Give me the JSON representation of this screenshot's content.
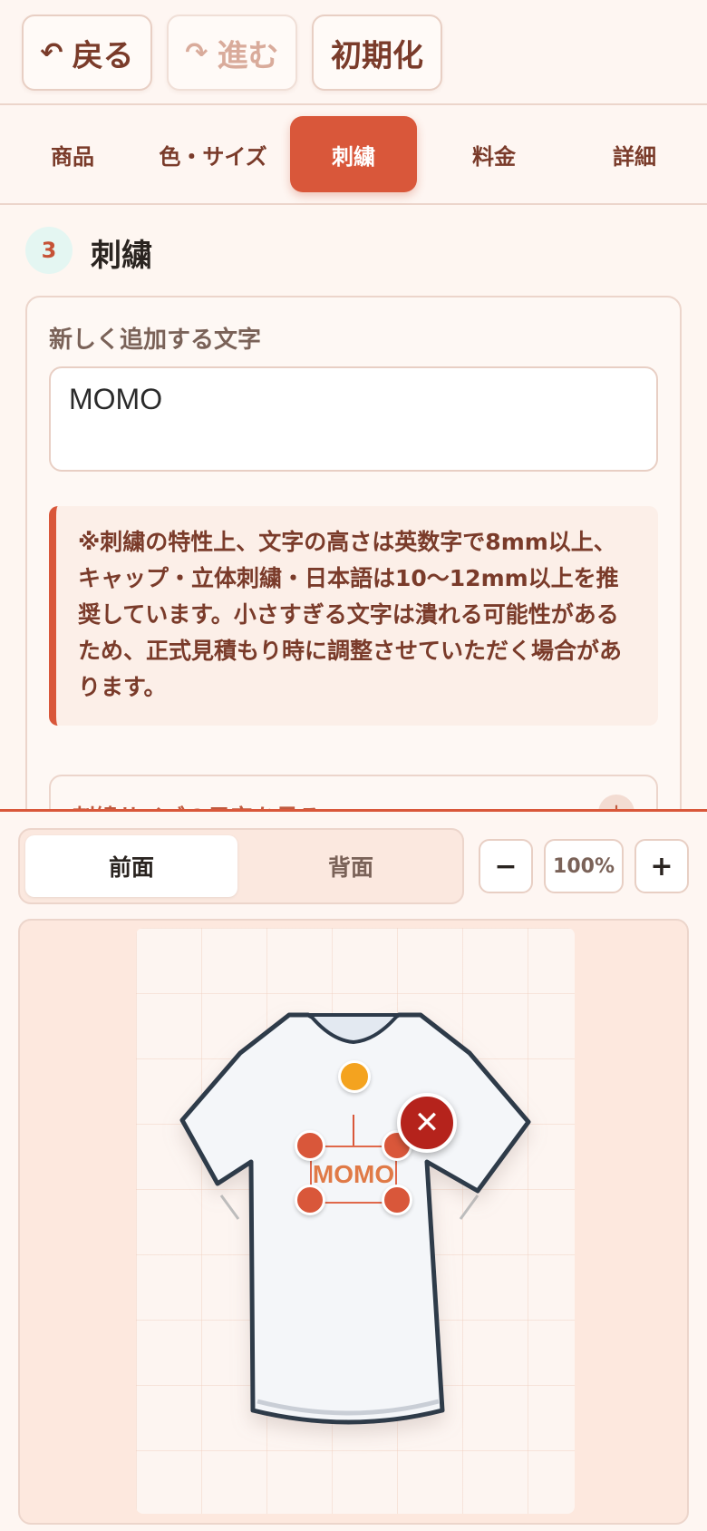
{
  "toolbar": {
    "back": {
      "icon": "↶",
      "label": "戻る"
    },
    "forward": {
      "icon": "↷",
      "label": "進む"
    },
    "reset_label": "初期化"
  },
  "steps": [
    {
      "label": "商品"
    },
    {
      "label": "色・サイズ"
    },
    {
      "label": "刺繍",
      "active": true
    },
    {
      "label": "料金"
    },
    {
      "label": "詳細"
    }
  ],
  "section": {
    "number": "3",
    "title": "刺繍",
    "field_label": "新しく追加する文字",
    "text_value": "MOMO",
    "notice": "※刺繍の特性上、文字の高さは英数字で8mm以上、キャップ・立体刺繍・日本語は10〜12mm以上を推奨しています。小さすぎる文字は潰れる可能性があるため、正式見積もり時に調整させていただく場合があります。",
    "accordion_label": "刺繍サイズの目安を見る",
    "accordion_icon": "+"
  },
  "preview": {
    "side_front": "前面",
    "side_back": "背面",
    "zoom_minus": "−",
    "zoom_level": "100%",
    "zoom_plus": "+",
    "design_text": "MOMO",
    "delete_icon": "✕"
  },
  "colors": {
    "accent": "#d9573a",
    "delete": "#b5231c",
    "rotate_handle": "#f4a31f",
    "shirt_outline": "#2d3a4a"
  }
}
